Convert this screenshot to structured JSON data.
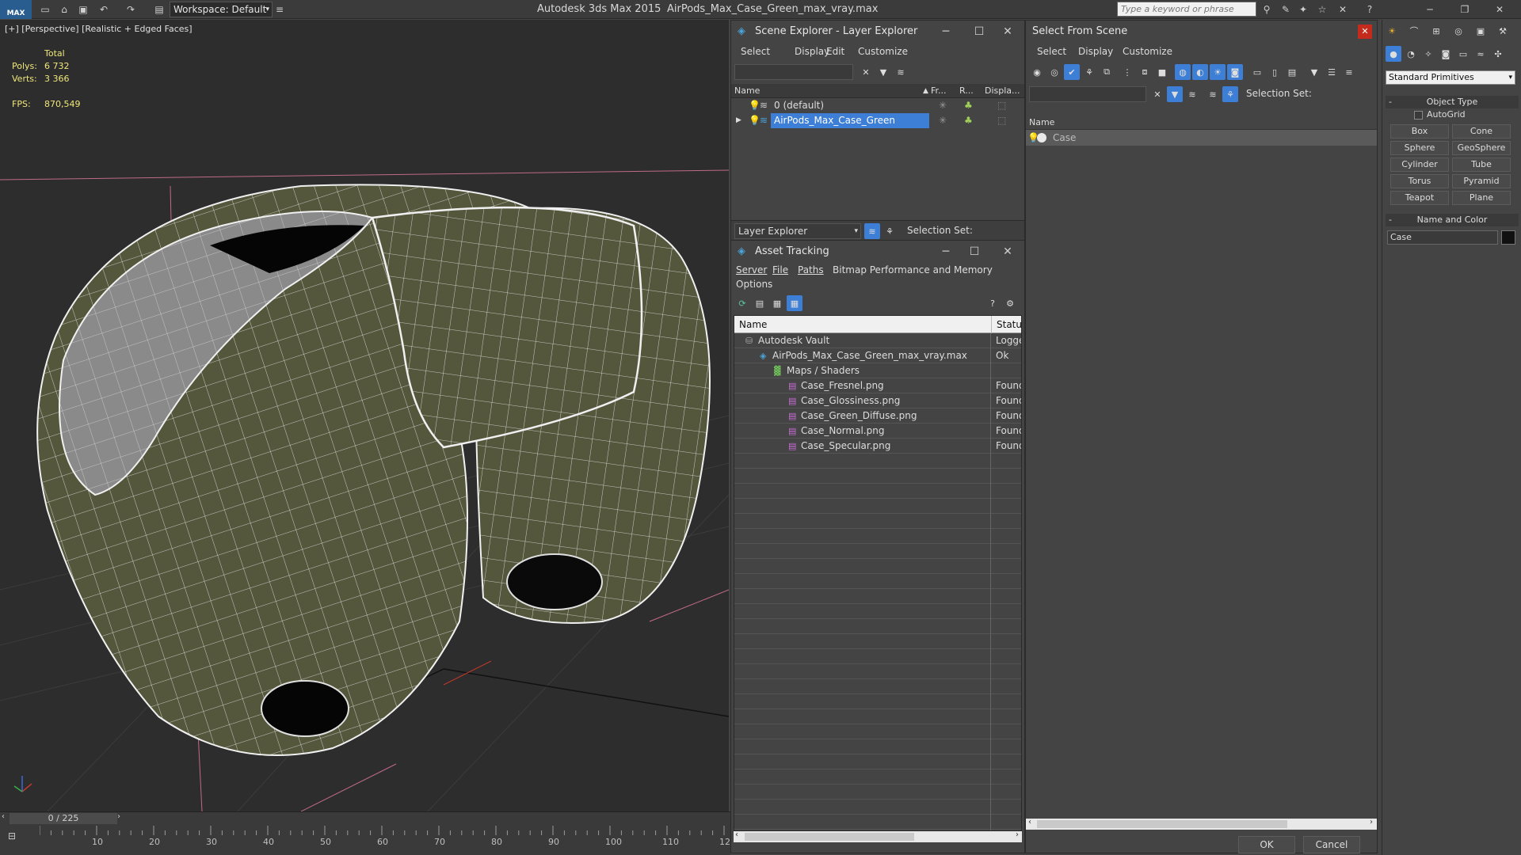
{
  "titlebar": {
    "logo": "MAX",
    "workspace": "Workspace: Default",
    "app_title": "Autodesk 3ds Max  2015",
    "file_name": "AirPods_Max_Case_Green_max_vray.max",
    "search_placeholder": "Type a keyword or phrase"
  },
  "viewport": {
    "label": "[+] [Perspective] [Realistic + Edged Faces]",
    "stats_header": "Total",
    "polys_label": "Polys:",
    "polys_value": "6 732",
    "verts_label": "Verts:",
    "verts_value": "3 366",
    "fps_label": "FPS:",
    "fps_value": "870,549"
  },
  "timeline": {
    "slider": "0 / 225",
    "ticks": [
      "10",
      "20",
      "30",
      "40",
      "50",
      "60",
      "70",
      "80",
      "90",
      "100",
      "110",
      "12"
    ]
  },
  "scene_explorer": {
    "title": "Scene Explorer - Layer Explorer",
    "menu": [
      "Select",
      "Display",
      "Edit",
      "Customize"
    ],
    "columns": [
      "Name",
      "Fr...",
      "R...",
      "Displa..."
    ],
    "rows": [
      {
        "name": "0 (default)",
        "selected": false
      },
      {
        "name": "AirPods_Max_Case_Green",
        "selected": true
      }
    ],
    "footer_dropdown": "Layer Explorer",
    "footer_selset": "Selection Set:"
  },
  "asset_tracking": {
    "title": "Asset Tracking",
    "menu": [
      "Server",
      "File",
      "Paths",
      "Bitmap Performance and Memory"
    ],
    "menu2": "Options",
    "columns": [
      "Name",
      "Status"
    ],
    "rows": [
      {
        "name": "Autodesk Vault",
        "status": "Logged",
        "indent": 0,
        "icon": "vault-icon"
      },
      {
        "name": "AirPods_Max_Case_Green_max_vray.max",
        "status": "Ok",
        "indent": 1,
        "icon": "max-file-icon"
      },
      {
        "name": "Maps / Shaders",
        "status": "",
        "indent": 2,
        "icon": "maps-icon"
      },
      {
        "name": "Case_Fresnel.png",
        "status": "Found",
        "indent": 3,
        "icon": "png-icon"
      },
      {
        "name": "Case_Glossiness.png",
        "status": "Found",
        "indent": 3,
        "icon": "png-icon"
      },
      {
        "name": "Case_Green_Diffuse.png",
        "status": "Found",
        "indent": 3,
        "icon": "png-icon"
      },
      {
        "name": "Case_Normal.png",
        "status": "Found",
        "indent": 3,
        "icon": "png-icon"
      },
      {
        "name": "Case_Specular.png",
        "status": "Found",
        "indent": 3,
        "icon": "png-icon"
      }
    ]
  },
  "select_from_scene": {
    "title": "Select From Scene",
    "menu": [
      "Select",
      "Display",
      "Customize"
    ],
    "selset": "Selection Set:",
    "column": "Name",
    "rows": [
      {
        "name": "Case"
      }
    ],
    "ok": "OK",
    "cancel": "Cancel"
  },
  "command_panel": {
    "dropdown": "Standard Primitives",
    "object_type": "Object Type",
    "autogrid": "AutoGrid",
    "buttons": [
      "Box",
      "Cone",
      "Sphere",
      "GeoSphere",
      "Cylinder",
      "Tube",
      "Torus",
      "Pyramid",
      "Teapot",
      "Plane"
    ],
    "name_and_color": "Name and Color",
    "object_name": "Case",
    "object_color": "#111111"
  },
  "colors": {
    "accent": "#3d7fd6",
    "mesh": "#55573d",
    "wire": "#e8e8e8",
    "stats": "#f0e77a",
    "close_red": "#c42b1c"
  }
}
